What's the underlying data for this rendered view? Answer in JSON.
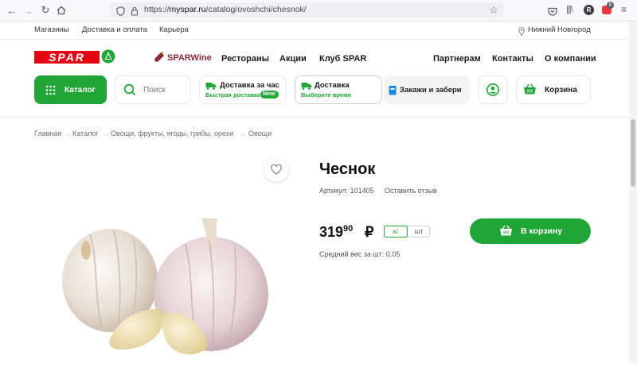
{
  "browser": {
    "url_prefix": "https://",
    "url_host": "myspar.ru",
    "url_path": "/catalog/ovoshchi/chesnok/",
    "avatar_letter": "R",
    "badge_count": "6"
  },
  "toplinks": {
    "stores": "Магазины",
    "delivery_payment": "Доставка и оплата",
    "career": "Карьера",
    "city": "Нижний Новгород"
  },
  "logo": {
    "text": "SPAR"
  },
  "mainnav": {
    "sparwine": "SPARWine",
    "restaurants": "Рестораны",
    "promotions": "Акции",
    "club": "Клуб SPAR",
    "partners": "Партнерам",
    "contacts": "Контакты",
    "about": "О компании"
  },
  "services": {
    "catalog": "Каталог",
    "search_placeholder": "Поиск",
    "delivery_hour": "Доставка за час",
    "fast_delivery": "Быстрая доставка",
    "new_badge": "New!",
    "delivery": "Доставка",
    "choose_time": "Выберите время",
    "order_pickup": "Закажи и забери",
    "cart": "Корзина"
  },
  "breadcrumbs": [
    "Главная",
    "Каталог",
    "Овощи, фрукты, ягоды, грибы, орехи",
    "Овощи"
  ],
  "product": {
    "title": "Чеснок",
    "article": "Артикул: 101405",
    "review_link": "Оставить отзыв",
    "price_rub": "319",
    "price_kop": "90",
    "currency": "₽",
    "unit_kg": "кг",
    "unit_piece": "шт",
    "add_to_cart": "В корзину",
    "avg_weight": "Средний вес за шт: 0.05"
  },
  "colors": {
    "brand_green": "#21a537",
    "brand_red": "#e30613"
  }
}
